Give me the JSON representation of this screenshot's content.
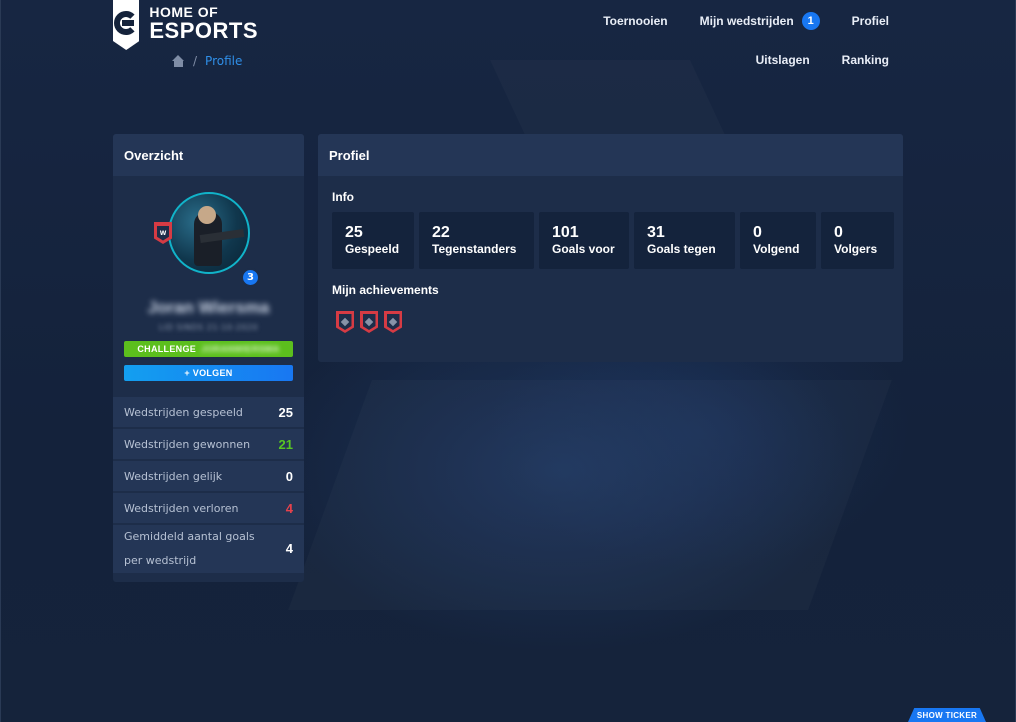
{
  "logo": {
    "line1": "HOME OF",
    "line2": "ESPORTS"
  },
  "breadcrumb": {
    "current": "Profile",
    "separator": "/"
  },
  "nav": {
    "top": [
      {
        "label": "Toernooien"
      },
      {
        "label": "Mijn wedstrijden",
        "badge": "1"
      },
      {
        "label": "Profiel"
      }
    ],
    "bottom": [
      {
        "label": "Uitslagen"
      },
      {
        "label": "Ranking"
      }
    ]
  },
  "overview": {
    "title": "Overzicht",
    "rank_badge_text": "W",
    "level": "3",
    "player_name": "Joran Wiersma",
    "player_sub": "LID SINDS 21-10-2020",
    "challenge_label": "CHALLENGE",
    "challenge_target": "JORANWIERSMA",
    "follow_label": "+ VOLGEN",
    "stats": [
      {
        "label": "Wedstrijden gespeeld",
        "value": "25",
        "tone": "white"
      },
      {
        "label": "Wedstrijden gewonnen",
        "value": "21",
        "tone": "green"
      },
      {
        "label": "Wedstrijden gelijk",
        "value": "0",
        "tone": "white"
      },
      {
        "label": "Wedstrijden verloren",
        "value": "4",
        "tone": "red"
      },
      {
        "label": "Gemiddeld aantal goals per wedstrijd",
        "value": "4",
        "tone": "white"
      }
    ]
  },
  "profile": {
    "title": "Profiel",
    "info_title": "Info",
    "cards": [
      {
        "value": "25",
        "label": "Gespeeld"
      },
      {
        "value": "22",
        "label": "Tegenstanders"
      },
      {
        "value": "101",
        "label": "Goals voor"
      },
      {
        "value": "31",
        "label": "Goals tegen"
      },
      {
        "value": "0",
        "label": "Volgend"
      },
      {
        "value": "0",
        "label": "Volgers"
      }
    ],
    "achievements_title": "Mijn achievements",
    "achievement_icons": [
      "achievement-shield-icon",
      "achievement-shield-icon",
      "achievement-shield-icon"
    ]
  },
  "ticker": {
    "label": "SHOW TICKER"
  },
  "colors": {
    "background": "#15233b",
    "panel": "#1d2d49",
    "panel_header": "#243656",
    "accent_blue": "#1877f2",
    "green": "#5cbf1d",
    "red": "#e5424c"
  }
}
